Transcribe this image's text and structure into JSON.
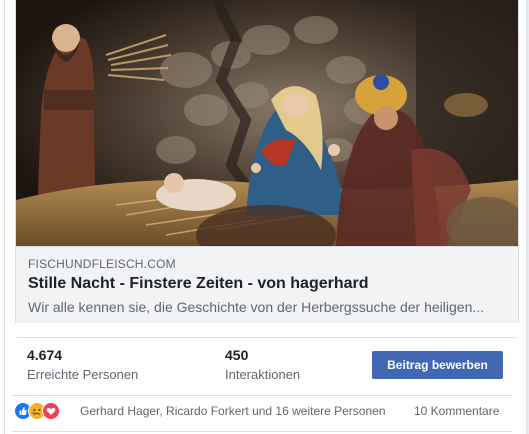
{
  "post": {
    "link_preview": {
      "image_icon": "nativity-scene-photo",
      "domain": "FISCHUNDFLEISCH.COM",
      "title": "Stille Nacht - Finstere Zeiten - von hagerhard",
      "description": "Wir alle kennen sie, die Geschichte von der Herbergssuche der heiligen..."
    },
    "insights": {
      "reach": {
        "value": "4.674",
        "label": "Erreichte Personen"
      },
      "engagement": {
        "value": "450",
        "label": "Interaktionen"
      },
      "boost_label": "Beitrag bewerben"
    },
    "footer": {
      "reaction_icons": [
        "like-icon",
        "sad-icon",
        "love-icon"
      ],
      "reactors_text": "Gerhard Hager, Ricardo Forkert und 16 weitere Personen",
      "comments_text": "10 Kommentare"
    }
  },
  "colors": {
    "accent": "#4267b2",
    "like": "#1877f2",
    "sad": "#f7b125",
    "love": "#f33e58"
  }
}
